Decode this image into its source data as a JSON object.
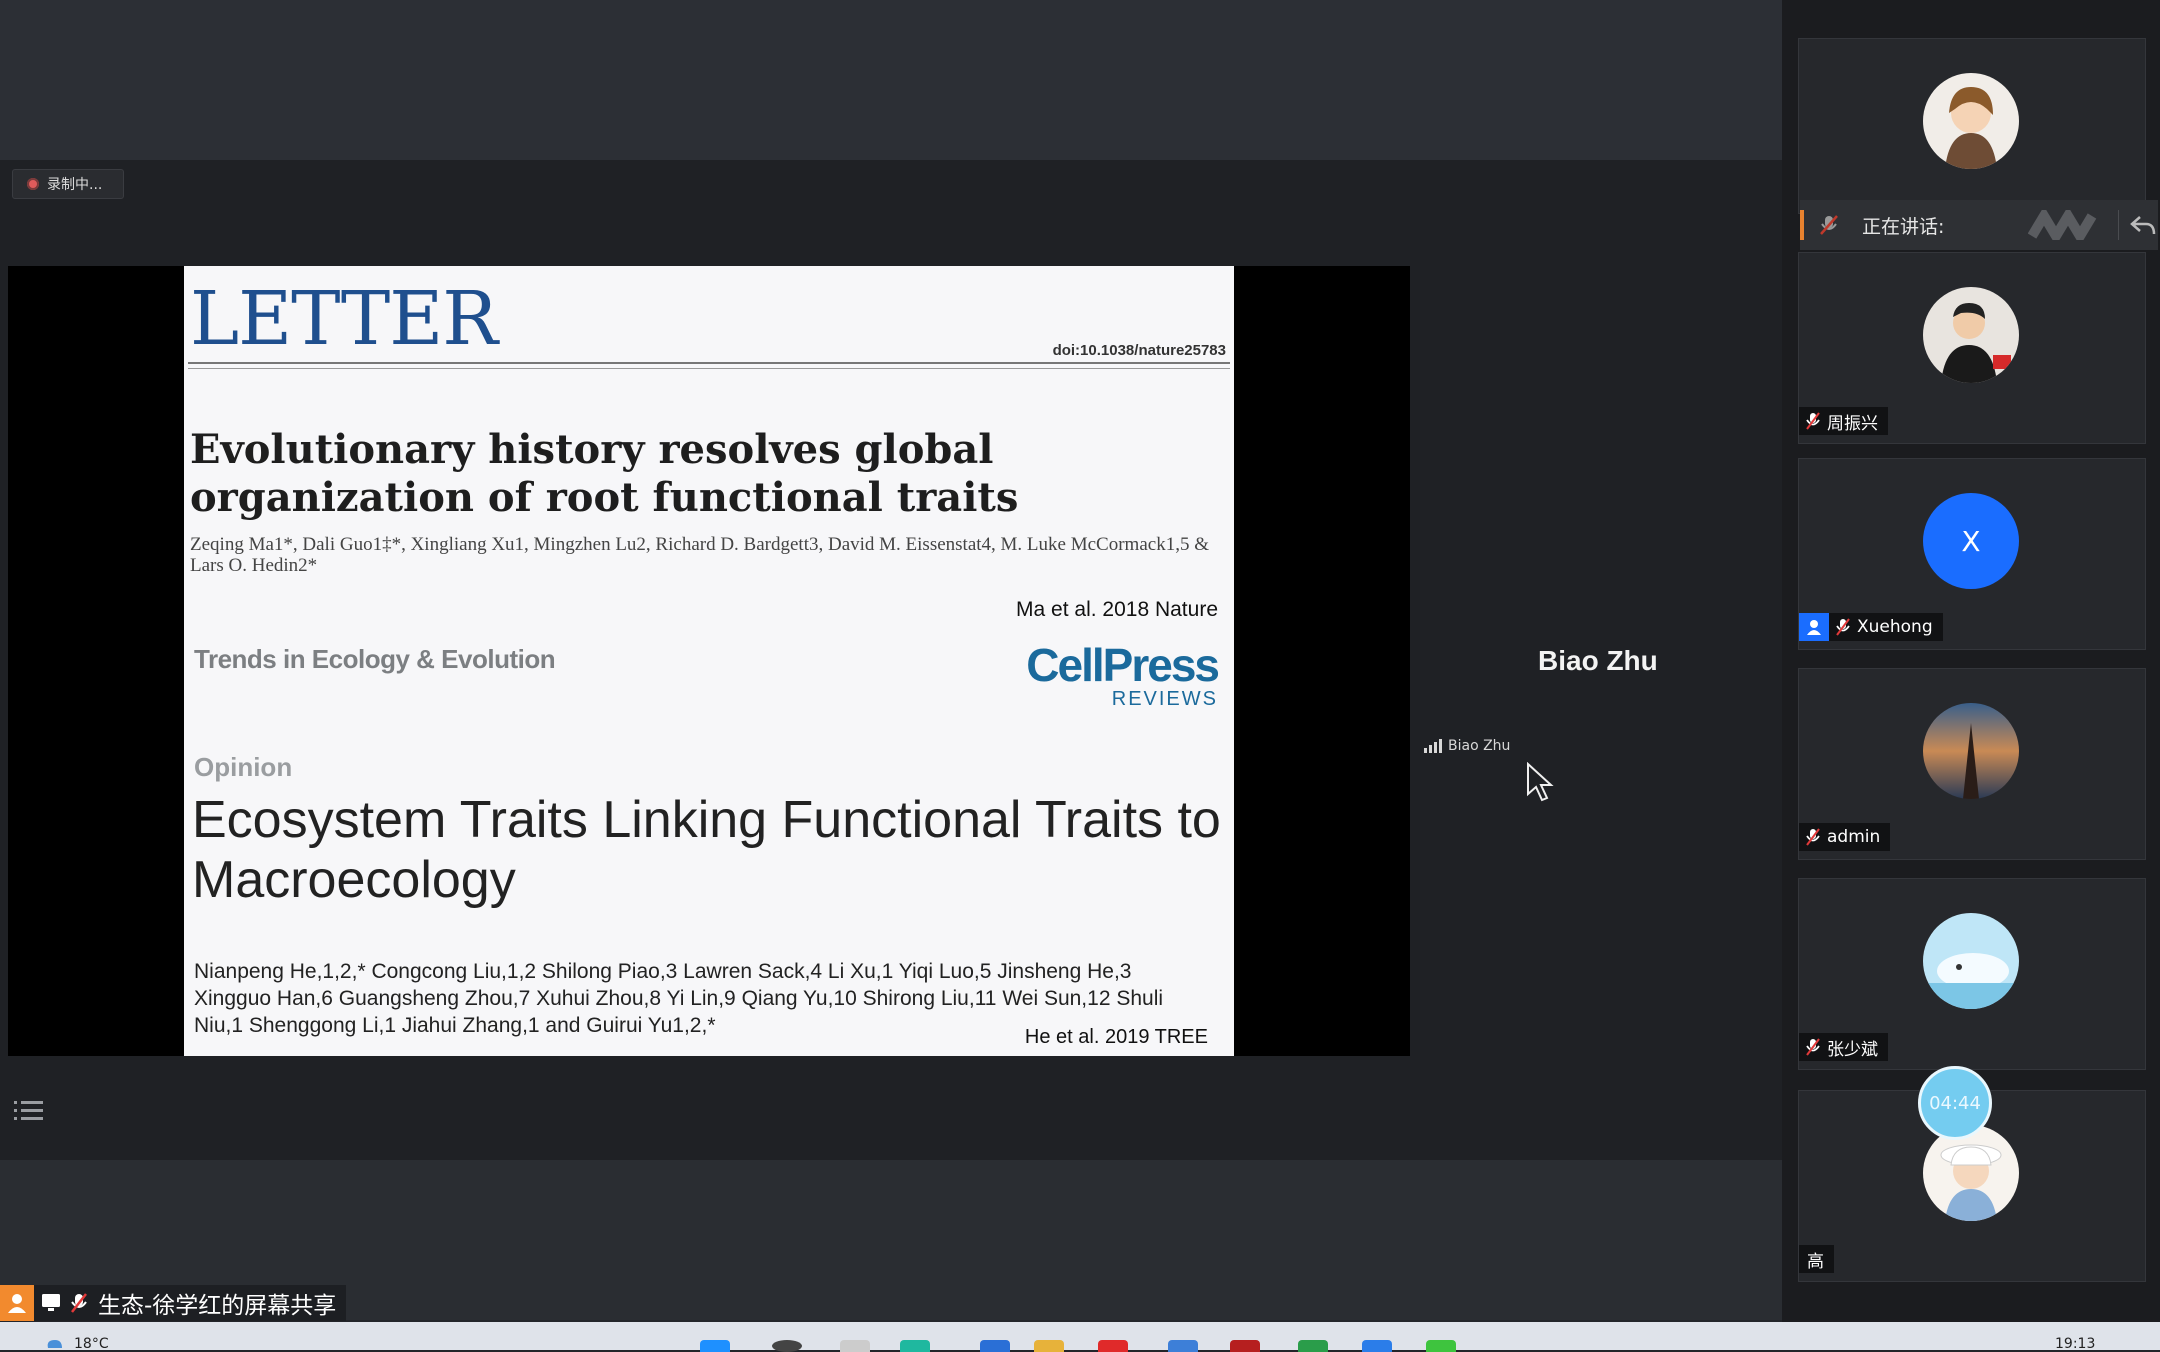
{
  "recording": {
    "label": "录制中..."
  },
  "slide": {
    "letter_heading": "LETTER",
    "doi": "doi:10.1038/nature25783",
    "paper1_title": "Evolutionary history resolves global organization of root functional traits",
    "paper1_authors": "Zeqing Ma1*, Dali Guo1‡*, Xingliang Xu1, Mingzhen Lu2, Richard D. Bardgett3, David M. Eissenstat4, M. Luke McCormack1,5 & Lars O. Hedin2*",
    "paper1_citation": "Ma et al. 2018 Nature",
    "journal2": "Trends in Ecology & Evolution",
    "publisher_logo": "CellPress",
    "publisher_sub": "REVIEWS",
    "section": "Opinion",
    "paper2_title": "Ecosystem Traits Linking Functional Traits to Macroecology",
    "paper2_authors": "Nianpeng He,1,2,* Congcong Liu,1,2 Shilong Piao,3 Lawren Sack,4 Li Xu,1 Yiqi Luo,5 Jinsheng He,3 Xingguo Han,6 Guangsheng Zhou,7 Xuhui Zhou,8 Yi Lin,9 Qiang Yu,10 Shirong Liu,11 Wei Sun,12 Shuli Niu,1 Shenggong Li,1 Jiahui Zhang,1 and Guirui Yu1,2,*",
    "paper2_citation": "He et al. 2019 TREE"
  },
  "presenter": {
    "name": "Biao Zhu",
    "tag": "Biao Zhu"
  },
  "share_bar": {
    "text": "生态-徐学红的屏幕共享"
  },
  "sidebar": {
    "speaking_label": "正在讲话:",
    "participants": [
      {
        "name": ""
      },
      {
        "name": "周振兴"
      },
      {
        "name": "Xuehong",
        "initial": "X"
      },
      {
        "name": "admin"
      },
      {
        "name": "张少斌"
      },
      {
        "name": "高"
      }
    ],
    "timer": "04:44"
  },
  "taskbar": {
    "temperature": "18°C",
    "time": "19:13"
  },
  "colors": {
    "accent_orange": "#f28a2e",
    "avatar_blue": "#1a6dff",
    "timer_blue": "#74ccf0"
  }
}
